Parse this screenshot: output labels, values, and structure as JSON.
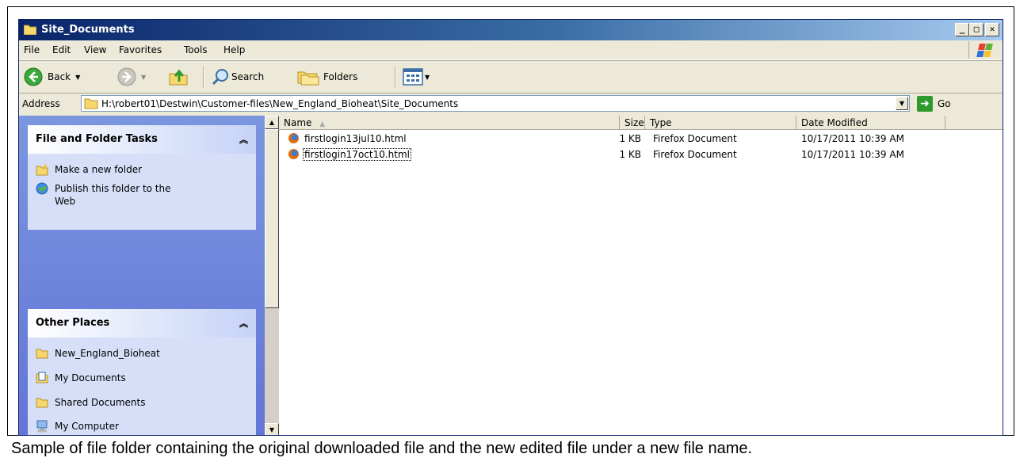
{
  "window": {
    "title": "Site_Documents",
    "controls": {
      "minimize": "_",
      "maximize": "□",
      "close": "✕"
    }
  },
  "menu": [
    "File",
    "Edit",
    "View",
    "Favorites",
    "Tools",
    "Help"
  ],
  "toolbar": {
    "back_label": "Back",
    "search_label": "Search",
    "folders_label": "Folders"
  },
  "address": {
    "label": "Address",
    "value": "H:\\robert01\\Destwin\\Customer-files\\New_England_Bioheat\\Site_Documents",
    "go_label": "Go"
  },
  "tasks_panel": {
    "title": "File and Folder Tasks",
    "items": [
      {
        "label": "Make a new folder",
        "icon": "new-folder-icon"
      },
      {
        "label": "Publish this folder to the Web",
        "icon": "publish-web-icon"
      }
    ]
  },
  "places_panel": {
    "title": "Other Places",
    "items": [
      {
        "label": "New_England_Bioheat",
        "icon": "folder-icon"
      },
      {
        "label": "My Documents",
        "icon": "my-documents-icon"
      },
      {
        "label": "Shared Documents",
        "icon": "folder-icon"
      },
      {
        "label": "My Computer",
        "icon": "my-computer-icon"
      }
    ]
  },
  "columns": {
    "name": "Name",
    "size": "Size",
    "type": "Type",
    "date": "Date Modified"
  },
  "files": [
    {
      "name": "firstlogin13jul10.html",
      "size": "1 KB",
      "type": "Firefox Document",
      "date": "10/17/2011 10:39 AM"
    },
    {
      "name": "firstlogin17oct10.html",
      "size": "1 KB",
      "type": "Firefox Document",
      "date": "10/17/2011 10:39 AM"
    }
  ],
  "caption": "Sample of file folder containing the original downloaded file and the new edited file under a new file name.",
  "colors": {
    "title_bar": "#0a246a",
    "task_pane": "#6375d6",
    "panel_body": "#d6dff7"
  }
}
